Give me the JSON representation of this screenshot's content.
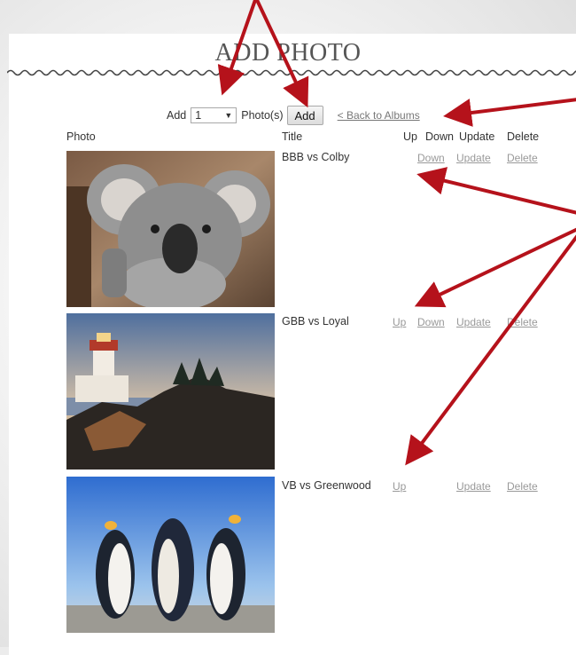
{
  "page": {
    "title": "ADD PHOTO"
  },
  "toolbar": {
    "add_label": "Add",
    "count_value": "1",
    "photos_label": "Photo(s)",
    "add_button": "Add",
    "back_link": "< Back to Albums"
  },
  "table": {
    "headers": {
      "photo": "Photo",
      "title": "Title",
      "up": "Up",
      "down": "Down",
      "update": "Update",
      "delete": "Delete"
    },
    "rows": [
      {
        "title": "BBB vs Colby",
        "down": "Down",
        "update": "Update",
        "delete": "Delete"
      },
      {
        "title": "GBB vs Loyal",
        "up": "Up",
        "down": "Down",
        "update": "Update",
        "delete": "Delete"
      },
      {
        "title": "VB vs Greenwood",
        "up": "Up",
        "update": "Update",
        "delete": "Delete"
      }
    ]
  },
  "colors": {
    "annotation_arrow": "#b5121b",
    "link": "#999999"
  },
  "icons": {
    "select_caret": "caret-down-icon"
  }
}
